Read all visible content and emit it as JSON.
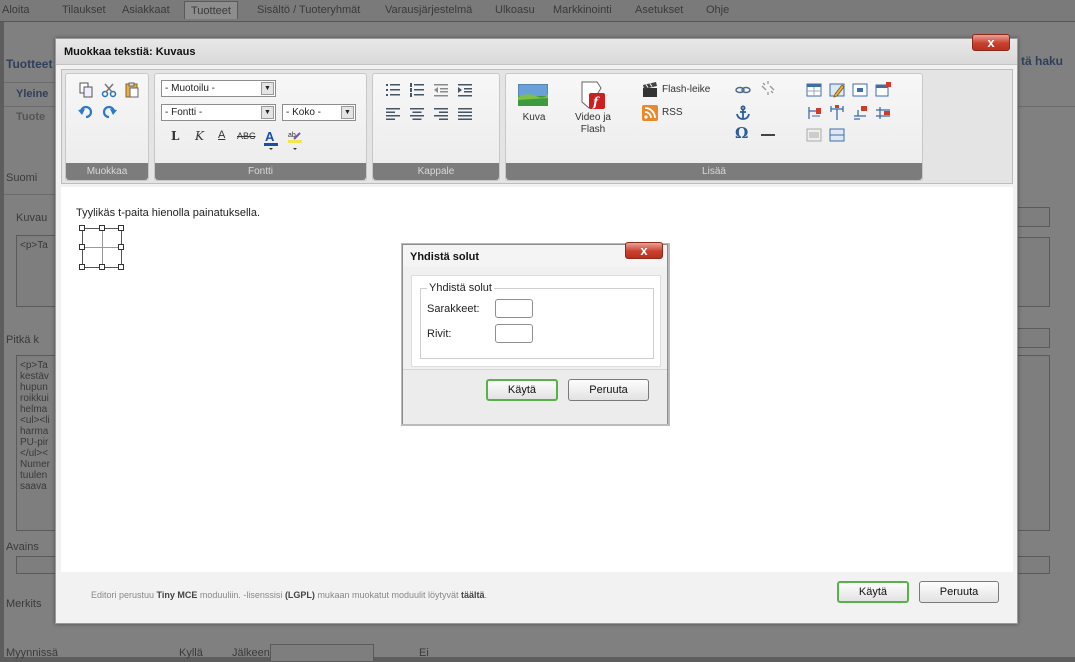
{
  "topnav": {
    "items": [
      "Aloita",
      "Tilaukset",
      "Asiakkaat",
      "Tuotteet",
      "Sisältö / Tuoteryhmät",
      "Varausjärjestelmä",
      "Ulkoasu",
      "Markkinointi",
      "Asetukset",
      "Ohje"
    ],
    "active": "Tuotteet"
  },
  "background": {
    "heading": "Tuotteet",
    "right_heading": "tä haku",
    "tab_general": "Yleine",
    "tab_products": "Tuote",
    "lang": "Suomi",
    "desc_label": "Kuvau",
    "desc_text": "<p>Ta",
    "long_label": "Pitkä k",
    "long_text": "<p>Ta\nkestäv\nhupun\nroikkui\nhelma\n<ul><li\nharma\nPU-pir\n</ul><\nNumer\ntuulen\nsaava",
    "keywords_label": "Avains",
    "marks_label": "Merkits",
    "sale_label": "Myynnissä",
    "opt_yes": "Kyllä",
    "opt_after": "Jälkeen",
    "opt_no": "Ei"
  },
  "editor": {
    "title": "Muokkaa tekstiä: Kuvaus",
    "close": "x",
    "groups": {
      "edit": "Muokkaa",
      "font": "Fontti",
      "paragraph": "Kappale",
      "more": "Lisää"
    },
    "selects": {
      "format": "- Muotoilu -",
      "font": "- Fontti -",
      "size": "- Koko -"
    },
    "buttons": {
      "image": "Kuva",
      "video": "Video ja\nFlash",
      "flash_clip": "Flash-leike",
      "rss": "RSS"
    },
    "content_text": "Tyylikäs t-paita hienolla painatuksella.",
    "footer": {
      "prefix": "Editori perustuu ",
      "tinymce": "Tiny MCE",
      "middle": " moduuliin. ",
      "license_prefix": "-lisenssisi ",
      "license": "(LGPL)",
      "license_suffix": " mukaan muokatut moduulit löytyvät ",
      "here": "täältä",
      "end": "."
    },
    "ok": "Käytä",
    "cancel": "Peruuta"
  },
  "dialog": {
    "title": "Yhdistä solut",
    "close": "x",
    "legend": "Yhdistä solut",
    "cols_label": "Sarakkeet:",
    "rows_label": "Rivit:",
    "cols_value": "",
    "rows_value": "",
    "ok": "Käytä",
    "cancel": "Peruuta"
  },
  "colors": {
    "close_red": "#c9402e",
    "primary_border": "#5ab04a",
    "group_label_bg": "#7c7c7c",
    "overlay": "#5d5d5d"
  }
}
